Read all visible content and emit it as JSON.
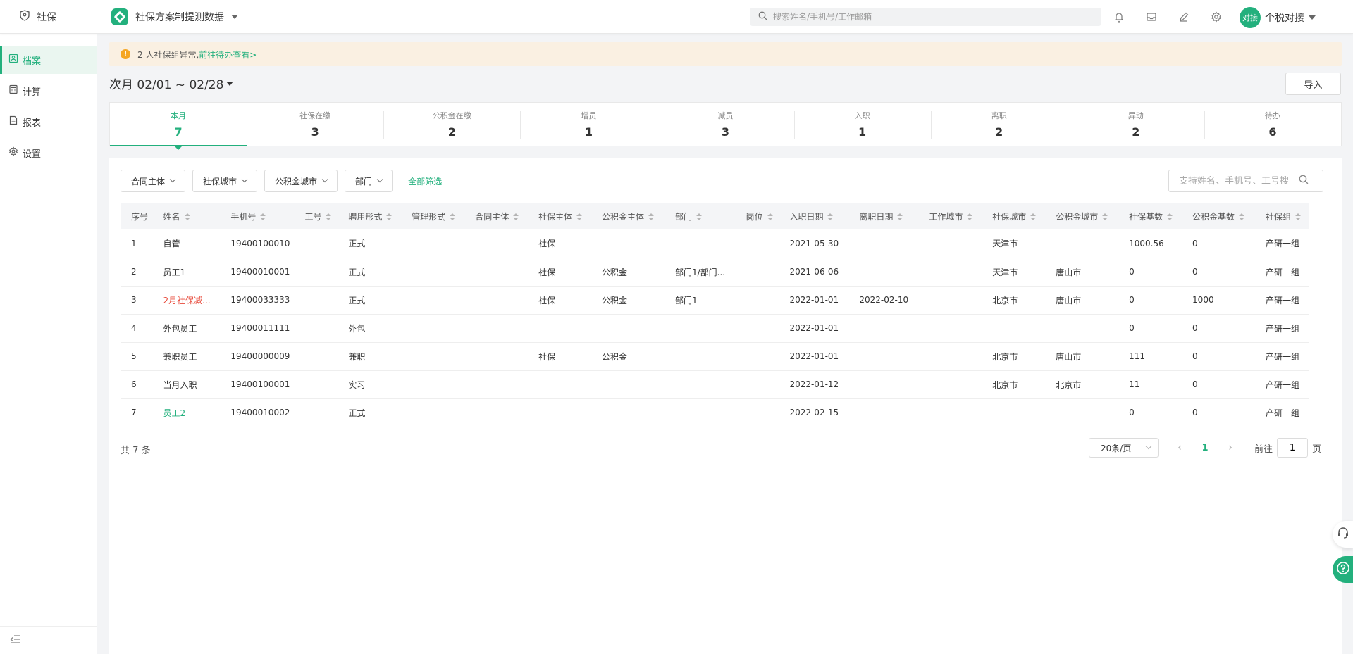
{
  "topbar": {
    "home_label": "社保",
    "app_title": "社保方案制提测数据",
    "search_placeholder": "搜索姓名/手机号/工作邮箱",
    "user_avatar_text": "对接",
    "user_name": "个税对接"
  },
  "sidebar": {
    "items": [
      {
        "label": "档案",
        "icon": "archive-icon",
        "active": true
      },
      {
        "label": "计算",
        "icon": "calculator-icon"
      },
      {
        "label": "报表",
        "icon": "report-icon"
      },
      {
        "label": "设置",
        "icon": "gear-icon"
      }
    ]
  },
  "alert": {
    "text": "2 人社保组异常,",
    "link": "前往待办查看>"
  },
  "period": {
    "label": "次月 02/01 ~ 02/28"
  },
  "import_label": "导入",
  "stats": [
    {
      "label": "本月",
      "value": "7"
    },
    {
      "label": "社保在缴",
      "value": "3"
    },
    {
      "label": "公积金在缴",
      "value": "2"
    },
    {
      "label": "增员",
      "value": "1"
    },
    {
      "label": "减员",
      "value": "3"
    },
    {
      "label": "入职",
      "value": "1"
    },
    {
      "label": "离职",
      "value": "2"
    },
    {
      "label": "异动",
      "value": "2"
    },
    {
      "label": "待办",
      "value": "6"
    }
  ],
  "filters": {
    "items": [
      "合同主体",
      "社保城市",
      "公积金城市",
      "部门"
    ],
    "all_label": "全部筛选",
    "search_placeholder": "支持姓名、手机号、工号搜"
  },
  "table": {
    "headers": [
      "序号",
      "姓名",
      "手机号",
      "工号",
      "聘用形式",
      "管理形式",
      "合同主体",
      "社保主体",
      "公积金主体",
      "部门",
      "岗位",
      "入职日期",
      "离职日期",
      "工作城市",
      "社保城市",
      "公积金城市",
      "社保基数",
      "公积金基数",
      "社保组"
    ],
    "rows": [
      [
        "1",
        "自管",
        "19400100010",
        "",
        "正式",
        "",
        "",
        "社保",
        "",
        "",
        "",
        "2021-05-30",
        "",
        "",
        "天津市",
        "",
        "1000.56",
        "0",
        "产研一组"
      ],
      [
        "2",
        "员工1",
        "19400010001",
        "",
        "正式",
        "",
        "",
        "社保",
        "公积金",
        "部门1/部门...",
        "",
        "2021-06-06",
        "",
        "",
        "天津市",
        "唐山市",
        "0",
        "0",
        "产研一组"
      ],
      [
        "3",
        "2月社保减...",
        "19400033333",
        "",
        "正式",
        "",
        "",
        "社保",
        "公积金",
        "部门1",
        "",
        "2022-01-01",
        "2022-02-10",
        "",
        "北京市",
        "唐山市",
        "0",
        "1000",
        "产研一组"
      ],
      [
        "4",
        "外包员工",
        "19400011111",
        "",
        "外包",
        "",
        "",
        "",
        "",
        "",
        "",
        "2022-01-01",
        "",
        "",
        "",
        "",
        "0",
        "0",
        "产研一组"
      ],
      [
        "5",
        "兼职员工",
        "19400000009",
        "",
        "兼职",
        "",
        "",
        "社保",
        "公积金",
        "",
        "",
        "2022-01-01",
        "",
        "",
        "北京市",
        "唐山市",
        "111",
        "0",
        "产研一组"
      ],
      [
        "6",
        "当月入职",
        "19400100001",
        "",
        "实习",
        "",
        "",
        "",
        "",
        "",
        "",
        "2022-01-12",
        "",
        "",
        "北京市",
        "北京市",
        "11",
        "0",
        "产研一组"
      ],
      [
        "7",
        "员工2",
        "19400010002",
        "",
        "正式",
        "",
        "",
        "",
        "",
        "",
        "",
        "2022-02-15",
        "",
        "",
        "",
        "",
        "0",
        "0",
        "产研一组"
      ]
    ]
  },
  "footer": {
    "total": "共 7 条",
    "page_size": "20条/页",
    "current_page": "1",
    "goto_label": "前往",
    "goto_value": "1",
    "page_suffix": "页"
  },
  "colors": {
    "accent": "#23b07d",
    "warning": "#f5a623",
    "danger": "#e84c3d"
  }
}
